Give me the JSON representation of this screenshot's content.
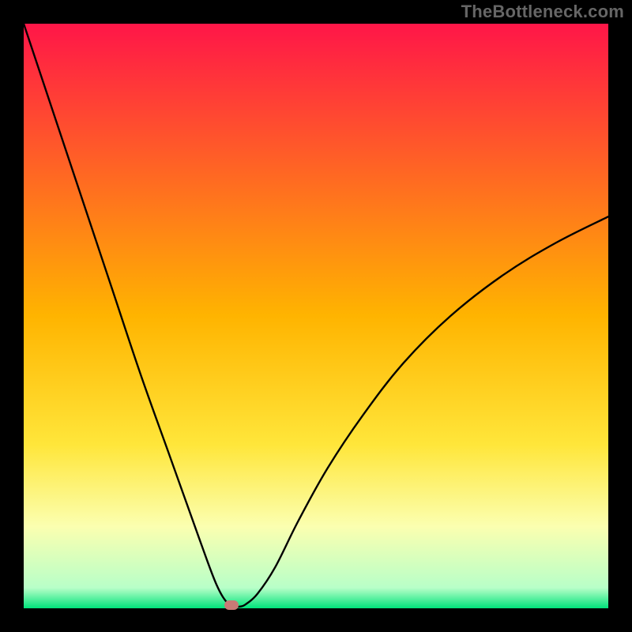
{
  "watermark": "TheBottleneck.com",
  "chart_data": {
    "type": "line",
    "title": "",
    "xlabel": "",
    "ylabel": "",
    "xlim": [
      0,
      100
    ],
    "ylim": [
      0,
      100
    ],
    "grid": false,
    "legend": false,
    "background_gradient": {
      "stops": [
        {
          "offset": 0.0,
          "color": "#ff1648"
        },
        {
          "offset": 0.5,
          "color": "#ffb400"
        },
        {
          "offset": 0.72,
          "color": "#ffe63a"
        },
        {
          "offset": 0.86,
          "color": "#fbffb0"
        },
        {
          "offset": 0.965,
          "color": "#b8ffc8"
        },
        {
          "offset": 1.0,
          "color": "#00e37a"
        }
      ]
    },
    "series": [
      {
        "name": "bottleneck-curve",
        "color": "#000000",
        "x": [
          0,
          5,
          10,
          15,
          20,
          25,
          30,
          33,
          35,
          36,
          37,
          38,
          40,
          43,
          47,
          52,
          58,
          65,
          73,
          82,
          91,
          100
        ],
        "y": [
          100,
          85,
          70,
          55,
          40,
          26,
          12,
          4,
          0.7,
          0.3,
          0.3,
          0.7,
          2.5,
          7,
          15,
          24,
          33,
          42,
          50,
          57,
          62.5,
          67
        ]
      }
    ],
    "marker": {
      "name": "optimal-point",
      "x": 35.5,
      "y": 0.5,
      "color": "#c97a76"
    }
  }
}
